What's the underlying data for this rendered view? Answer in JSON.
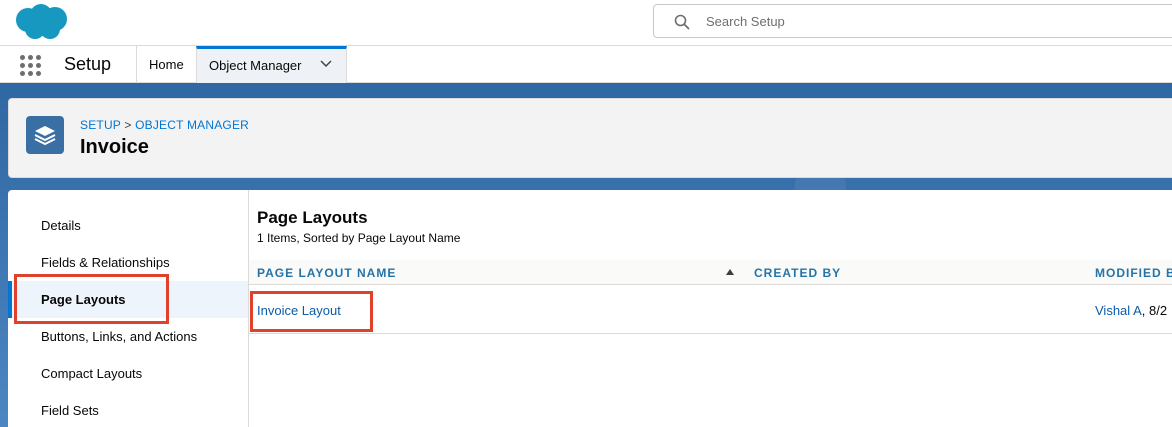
{
  "header": {
    "search": {
      "placeholder": "Search Setup"
    }
  },
  "navbar": {
    "app_name": "Setup",
    "tabs": [
      {
        "label": "Home"
      },
      {
        "label": "Object Manager"
      }
    ]
  },
  "object": {
    "breadcrumb": {
      "part1": "SETUP",
      "separator": ">",
      "part2": "OBJECT MANAGER"
    },
    "title": "Invoice"
  },
  "sidebar": {
    "items": [
      {
        "label": "Details"
      },
      {
        "label": "Fields & Relationships"
      },
      {
        "label": "Page Layouts"
      },
      {
        "label": "Buttons, Links, and Actions"
      },
      {
        "label": "Compact Layouts"
      },
      {
        "label": "Field Sets"
      }
    ]
  },
  "main": {
    "title": "Page Layouts",
    "subtitle": "1 Items, Sorted by Page Layout Name",
    "columns": [
      {
        "label": "PAGE LAYOUT NAME"
      },
      {
        "label": "CREATED BY"
      },
      {
        "label": "MODIFIED B"
      }
    ],
    "rows": [
      {
        "name": "Invoice Layout",
        "created_by": "",
        "modified_by": "Vishal A",
        "modified_rest": ", 8/2"
      }
    ]
  },
  "colors": {
    "brand": "#0176d3",
    "link": "#0b5cab",
    "highlight": "#e0412c",
    "banner": "#2c5f94"
  }
}
